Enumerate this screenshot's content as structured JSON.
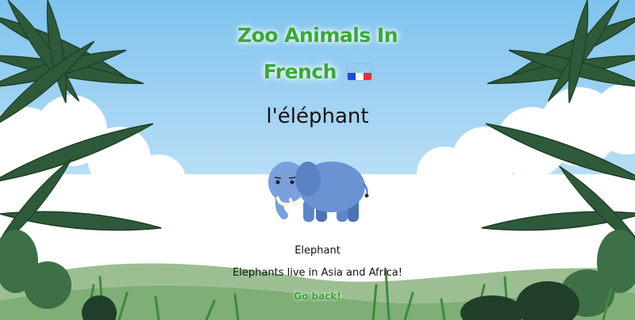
{
  "page": {
    "title": "Zoo Animals In French",
    "flag_icon": "french-flag-icon",
    "flag_colors": [
      "#1f4bd8",
      "#ffffff",
      "#e0323a"
    ]
  },
  "animal": {
    "french_name": "l'éléphant",
    "english_name": "Elephant",
    "fact": "Elephants live in Asia and Africa!",
    "illustration": "elephant-illustration"
  },
  "nav": {
    "back_label": "Go back!"
  },
  "colors": {
    "title": "#3aa83a",
    "sky_top": "#7ec3ee",
    "sky_bottom": "#d6ecfa",
    "leaves": "#2e5a3a",
    "grass": "#3f8a3a"
  }
}
